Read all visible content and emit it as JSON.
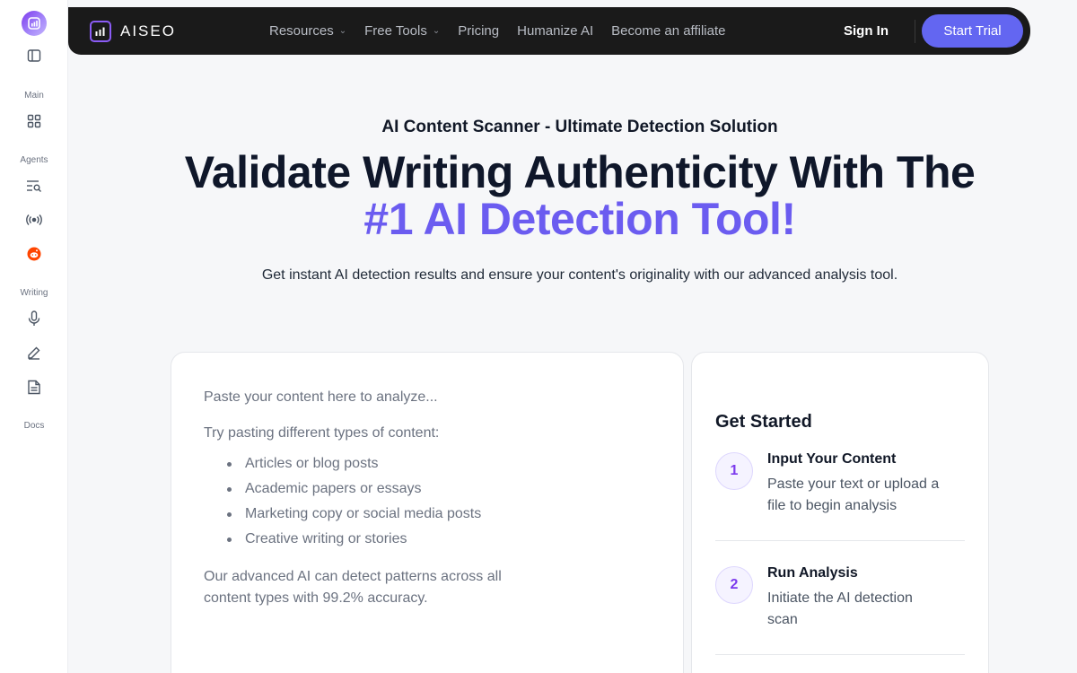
{
  "rail": {
    "sections": {
      "main": "Main",
      "agents": "Agents",
      "writing": "Writing",
      "docs": "Docs"
    },
    "icons": [
      "logo-icon",
      "sidebar-toggle-icon",
      "dashboard-grid-icon",
      "search-list-icon",
      "broadcast-icon",
      "reddit-icon",
      "microphone-icon",
      "pen-icon",
      "document-icon"
    ]
  },
  "nav": {
    "brand": "AISEO",
    "links": [
      {
        "label": "Resources",
        "has_dropdown": true
      },
      {
        "label": "Free Tools",
        "has_dropdown": true
      },
      {
        "label": "Pricing",
        "has_dropdown": false
      },
      {
        "label": "Humanize AI",
        "has_dropdown": false
      },
      {
        "label": "Become an affiliate",
        "has_dropdown": false
      }
    ],
    "sign_in": "Sign In",
    "start_trial": "Start Trial"
  },
  "hero": {
    "eyebrow": "AI Content Scanner - Ultimate Detection Solution",
    "headline_line1": "Validate Writing Authenticity With The",
    "headline_line2": "#1 AI Detection Tool!",
    "subhead": "Get instant AI detection results and ensure your content's originality with our advanced analysis tool."
  },
  "input": {
    "placeholder_line1": "Paste your content here to analyze...",
    "placeholder_line2": "Try pasting different types of content:",
    "examples": [
      "Articles or blog posts",
      "Academic papers or essays",
      "Marketing copy or social media posts",
      "Creative writing or stories"
    ],
    "placeholder_line3": "Our advanced AI can detect patterns across all content types with 99.2% accuracy."
  },
  "steps": {
    "title": "Get Started",
    "items": [
      {
        "num": "1",
        "title": "Input Your Content",
        "desc": "Paste your text or upload a file to begin analysis"
      },
      {
        "num": "2",
        "title": "Run Analysis",
        "desc": "Initiate the AI detection scan"
      }
    ]
  },
  "colors": {
    "accent": "#6366f1",
    "headline_accent": "#6b5cf0",
    "nav_bg": "#1a1a1a",
    "reddit": "#ff4500"
  }
}
